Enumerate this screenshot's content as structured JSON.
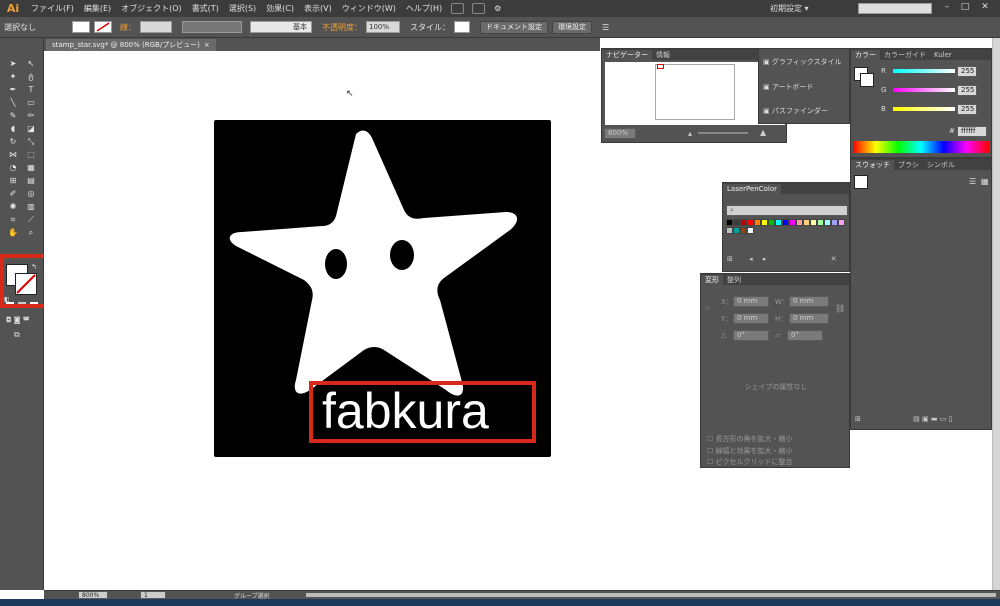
{
  "app": {
    "logo": "Ai",
    "menu": [
      "ファイル(F)",
      "編集(E)",
      "オブジェクト(O)",
      "書式(T)",
      "選択(S)",
      "効果(C)",
      "表示(V)",
      "ウィンドウ(W)",
      "ヘルプ(H)"
    ],
    "workspace": "初期設定 ▾",
    "window_buttons": [
      "–",
      "□",
      "✕"
    ]
  },
  "control_bar": {
    "selection": "選択なし",
    "stroke_label": "線：",
    "brush": "基本",
    "opacity_label": "不透明度：",
    "opacity_value": "100%",
    "style_label": "スタイル：",
    "doc_settings": "ドキュメント設定",
    "prefs": "環境設定"
  },
  "document": {
    "tab_title": "stamp_star.svg* @ 800% (RGB/プレビュー)",
    "tab_close": "×",
    "artwork_text": "fabkura"
  },
  "navigator": {
    "tabs": [
      "ナビゲーター",
      "情報"
    ],
    "zoom": "800%"
  },
  "side_panels": {
    "items": [
      "グラフィックスタイル",
      "アートボード",
      "パスファインダー"
    ]
  },
  "color_panel": {
    "tabs": [
      "カラー",
      "カラーガイド",
      "Kuler"
    ],
    "channels": [
      {
        "label": "R",
        "value": "255"
      },
      {
        "label": "G",
        "value": "255"
      },
      {
        "label": "B",
        "value": "255"
      }
    ],
    "hex_prefix": "#",
    "hex": "ffffff"
  },
  "swatch_panel": {
    "tabs": [
      "スウォッチ",
      "ブラシ",
      "シンボル"
    ]
  },
  "laser_panel": {
    "title": "LaserPenColor",
    "swatches": [
      "#000000",
      "#3a3a3a",
      "#c00000",
      "#ff0000",
      "#ff8000",
      "#ffff00",
      "#00c000",
      "#00ffff",
      "#0000ff",
      "#ff00ff",
      "#ffa0a0",
      "#ffd080",
      "#ffffa0",
      "#a0ffa0",
      "#a0ffff",
      "#a0a0ff",
      "#ffa0ff",
      "#c0c0c0",
      "#00a0a0",
      "#8b4513",
      "#ffffff"
    ]
  },
  "transform_panel": {
    "tabs": [
      "変形",
      "整列"
    ],
    "x_label": "X：",
    "x_value": "0 mm",
    "y_label": "Y：",
    "y_value": "0 mm",
    "w_label": "W：",
    "w_value": "0 mm",
    "h_label": "H：",
    "h_value": "0 mm",
    "rotate_value": "0°",
    "shear_value": "0°",
    "no_shape": "シェイプの属性なし",
    "checks": [
      "長方形の角を拡大・縮小",
      "線幅と効果を拡大・縮小",
      "ピクセルグリッドに整合"
    ]
  },
  "status": {
    "zoom": "800%",
    "page": "1",
    "tool": "グループ選択"
  },
  "colors": {
    "highlight": "#d8281a",
    "panel_bg": "#535353",
    "dark_bar": "#3c3c3c"
  }
}
